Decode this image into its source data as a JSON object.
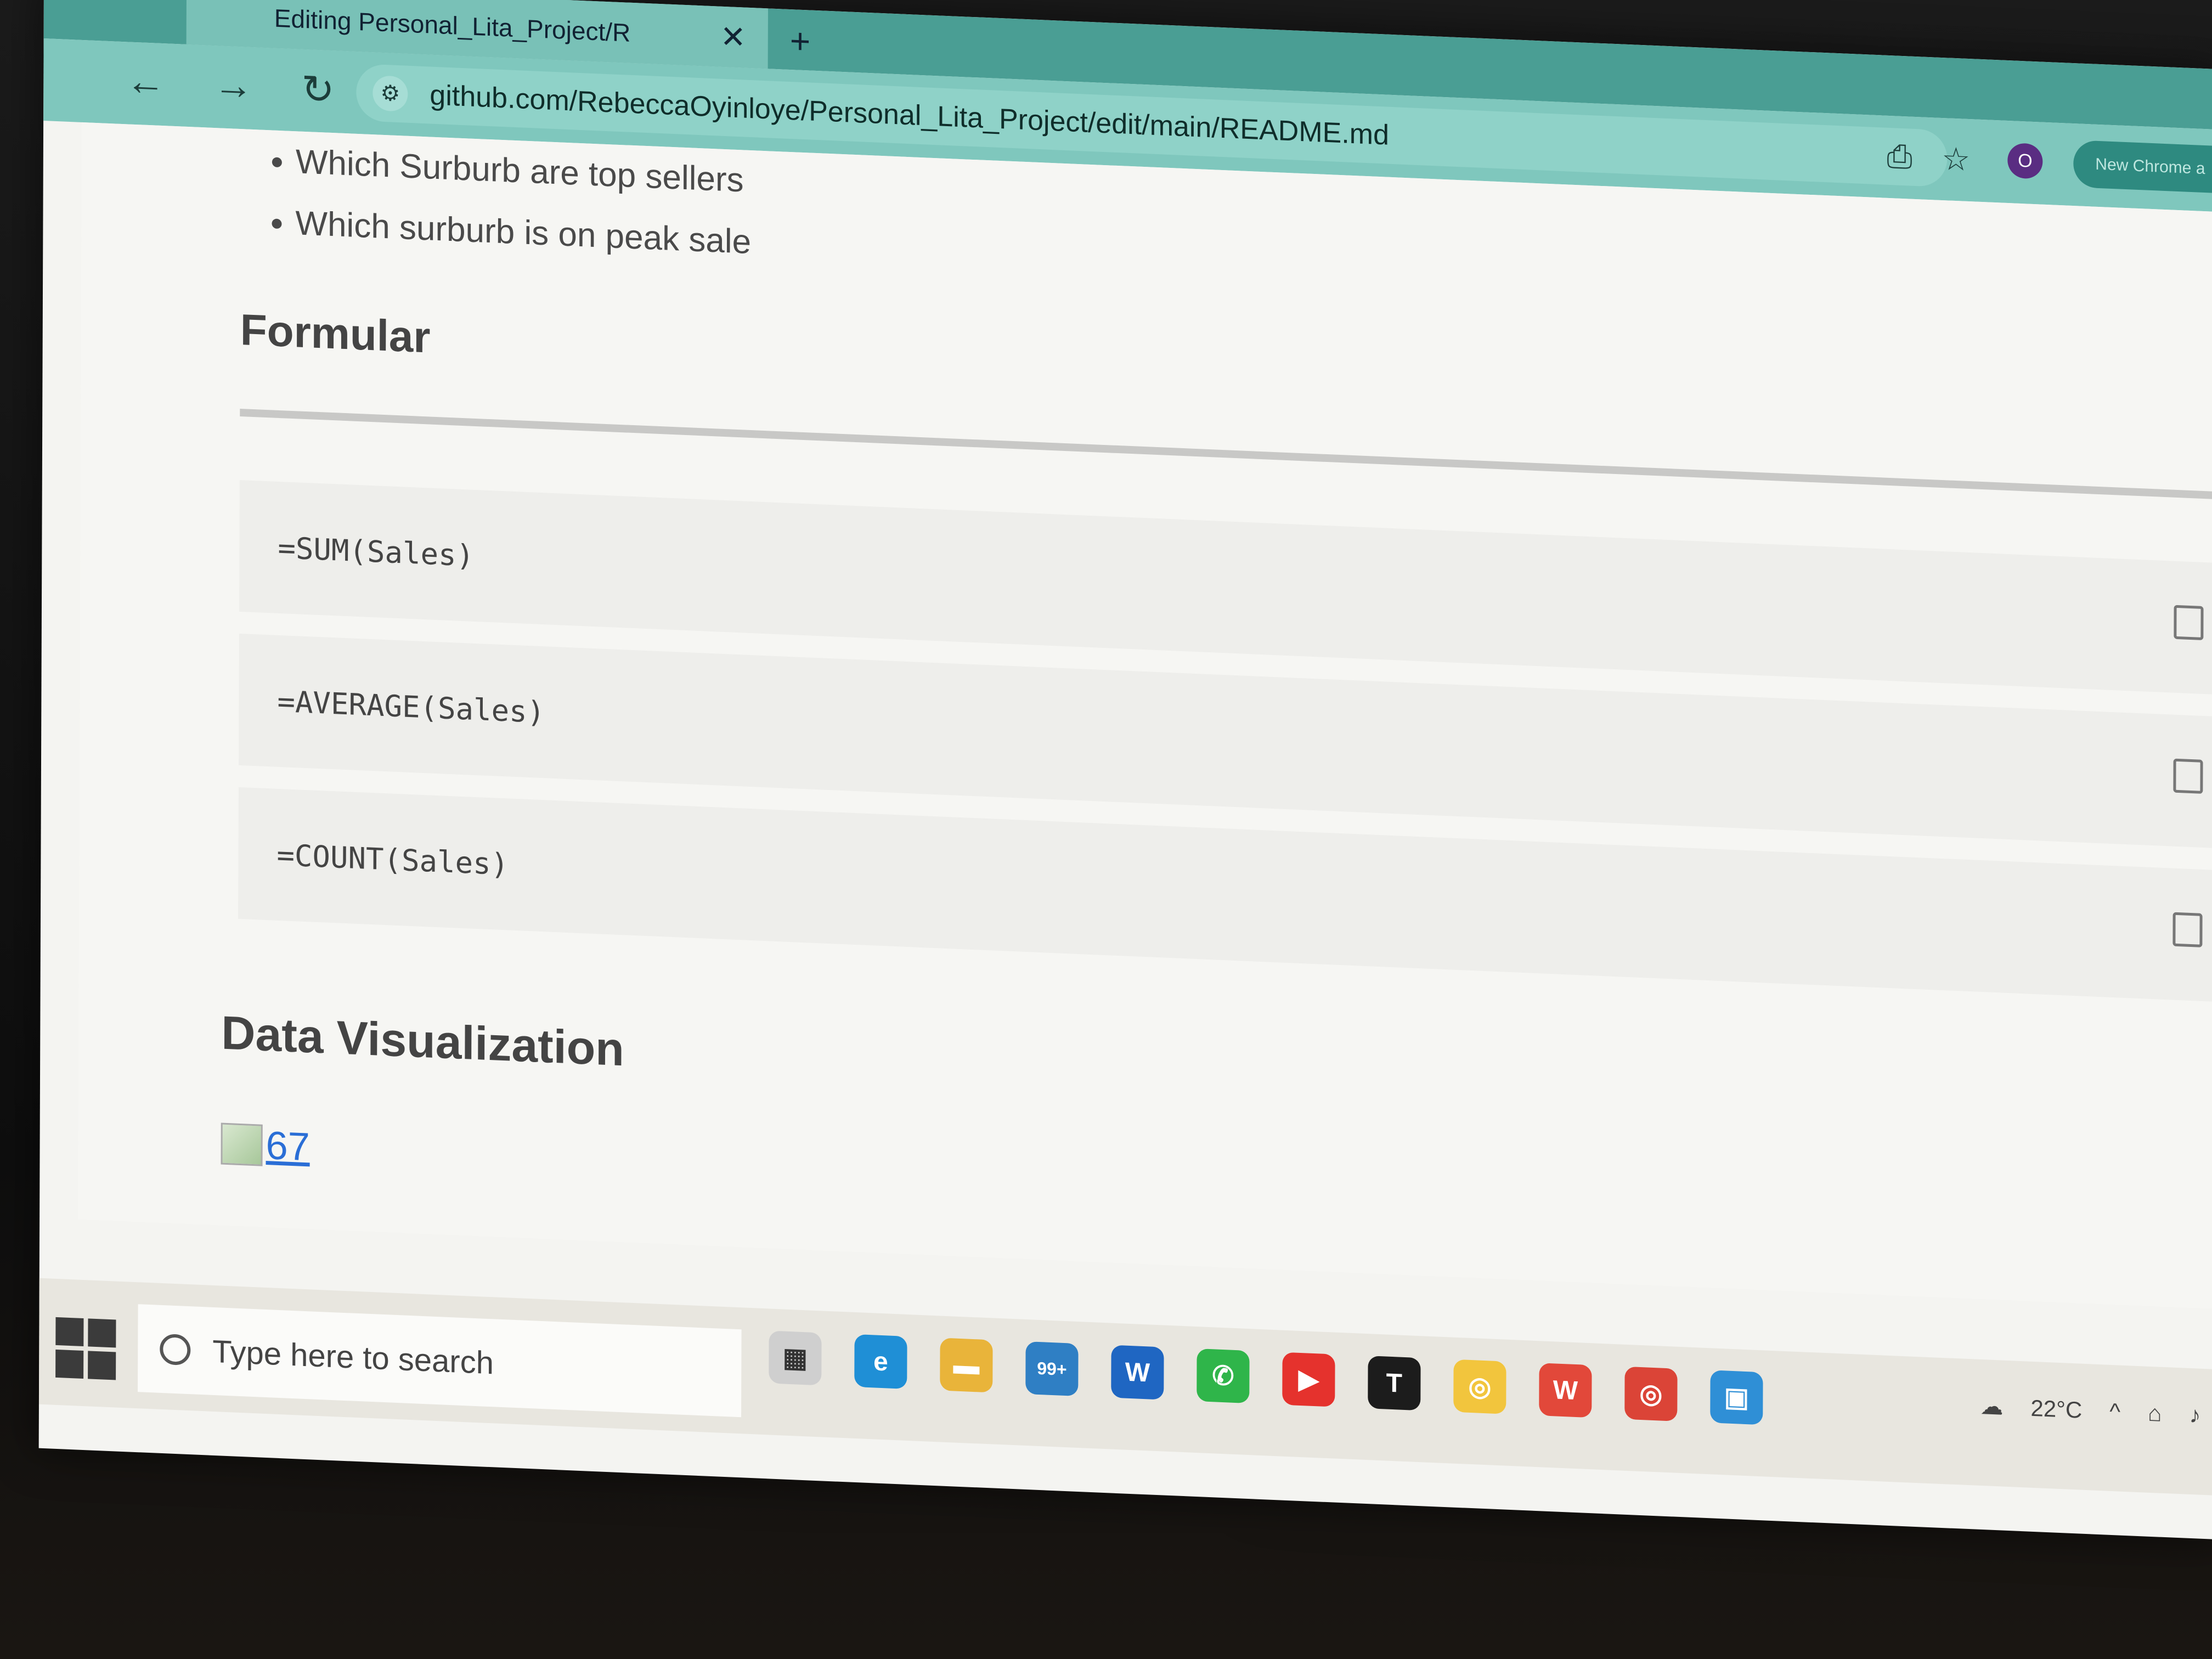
{
  "browser": {
    "tab_title": "Editing Personal_Lita_Project/R",
    "url": "github.com/RebeccaOyinloye/Personal_Lita_Project/edit/main/README.md",
    "profile_initial": "O",
    "new_chrome_label": "New Chrome a"
  },
  "readme": {
    "bullets": [
      "Which Surburb are top sellers",
      "Which surburb is on peak sale"
    ],
    "formular_heading": "Formular",
    "formulas": [
      "=SUM(Sales)",
      "=AVERAGE(Sales)",
      "=COUNT(Sales)"
    ],
    "dataviz_heading": "Data Visualization",
    "image_link_text": "67"
  },
  "taskbar": {
    "search_placeholder": "Type here to search",
    "mail_badge": "99+",
    "temperature": "22°C"
  },
  "colors": {
    "tab_bar": "#4a9e94",
    "toolbar": "#7fc7bd",
    "link": "#2a6ed6"
  }
}
